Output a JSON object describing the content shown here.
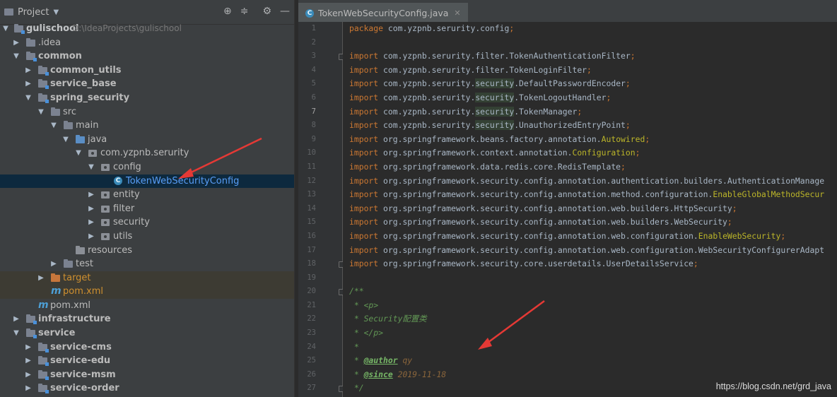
{
  "project_panel": {
    "title": "Project",
    "tree": [
      {
        "label": "gulischool",
        "path": "D:\\IdeaProjects\\gulischool",
        "bold": true
      },
      {
        "label": ".idea"
      },
      {
        "label": "common",
        "bold": true
      },
      {
        "label": "common_utils",
        "bold": true
      },
      {
        "label": "service_base",
        "bold": true
      },
      {
        "label": "spring_security",
        "bold": true
      },
      {
        "label": "src"
      },
      {
        "label": "main"
      },
      {
        "label": "java"
      },
      {
        "label": "com.yzpnb.serurity"
      },
      {
        "label": "config"
      },
      {
        "label": "TokenWebSecurityConfig"
      },
      {
        "label": "entity"
      },
      {
        "label": "filter"
      },
      {
        "label": "security"
      },
      {
        "label": "utils"
      },
      {
        "label": "resources"
      },
      {
        "label": "test"
      },
      {
        "label": "target"
      },
      {
        "label": "pom.xml",
        "prefix": "m"
      },
      {
        "label": "pom.xml",
        "prefix": "m"
      },
      {
        "label": "infrastructure",
        "bold": true
      },
      {
        "label": "service",
        "bold": true
      },
      {
        "label": "service-cms",
        "bold": true
      },
      {
        "label": "service-edu",
        "bold": true
      },
      {
        "label": "service-msm",
        "bold": true
      },
      {
        "label": "service-order",
        "bold": true
      }
    ]
  },
  "editor": {
    "tab": {
      "icon": "C",
      "label": "TokenWebSecurityConfig.java"
    },
    "line_numbers": [
      "1",
      "2",
      "3",
      "4",
      "5",
      "6",
      "7",
      "8",
      "9",
      "10",
      "11",
      "12",
      "13",
      "14",
      "15",
      "16",
      "17",
      "18",
      "19",
      "20",
      "21",
      "22",
      "23",
      "24",
      "25",
      "26",
      "27"
    ],
    "lines": [
      [
        "package com.yzpnb.serurity.config;"
      ],
      [
        ""
      ],
      [
        "import com.yzpnb.serurity.filter.TokenAuthenticationFilter;"
      ],
      [
        "import com.yzpnb.serurity.filter.TokenLoginFilter;"
      ],
      [
        "import com.yzpnb.serurity.",
        "security",
        ".DefaultPasswordEncoder;"
      ],
      [
        "import com.yzpnb.serurity.",
        "security",
        ".TokenLogoutHandler;"
      ],
      [
        "import com.yzpnb.serurity.",
        "security",
        ".TokenManager;"
      ],
      [
        "import com.yzpnb.serurity.",
        "security",
        ".UnauthorizedEntryPoint;"
      ],
      [
        "import org.springframework.beans.factory.annotation.",
        "Autowired",
        ";"
      ],
      [
        "import org.springframework.context.annotation.",
        "Configuration",
        ";"
      ],
      [
        "import org.springframework.data.redis.core.RedisTemplate;"
      ],
      [
        "import org.springframework.security.config.annotation.authentication.builders.AuthenticationManage"
      ],
      [
        "import org.springframework.security.config.annotation.method.configuration.",
        "EnableGlobalMethodSecur"
      ],
      [
        "import org.springframework.security.config.annotation.web.builders.HttpSecurity;"
      ],
      [
        "import org.springframework.security.config.annotation.web.builders.WebSecurity;"
      ],
      [
        "import org.springframework.security.config.annotation.web.configuration.",
        "EnableWebSecurity",
        ";"
      ],
      [
        "import org.springframework.security.config.annotation.web.configuration.WebSecurityConfigurerAdapt"
      ],
      [
        "import org.springframework.security.core.userdetails.UserDetailsService;"
      ],
      [
        ""
      ],
      [
        "/**"
      ],
      [
        " * <p>"
      ],
      [
        " * Security配置类"
      ],
      [
        " * </p>"
      ],
      [
        " *"
      ],
      [
        " * ",
        "@author",
        " qy"
      ],
      [
        " * ",
        "@since",
        " 2019-11-18"
      ],
      [
        " */"
      ]
    ]
  },
  "watermark": "https://blog.csdn.net/grd_java"
}
